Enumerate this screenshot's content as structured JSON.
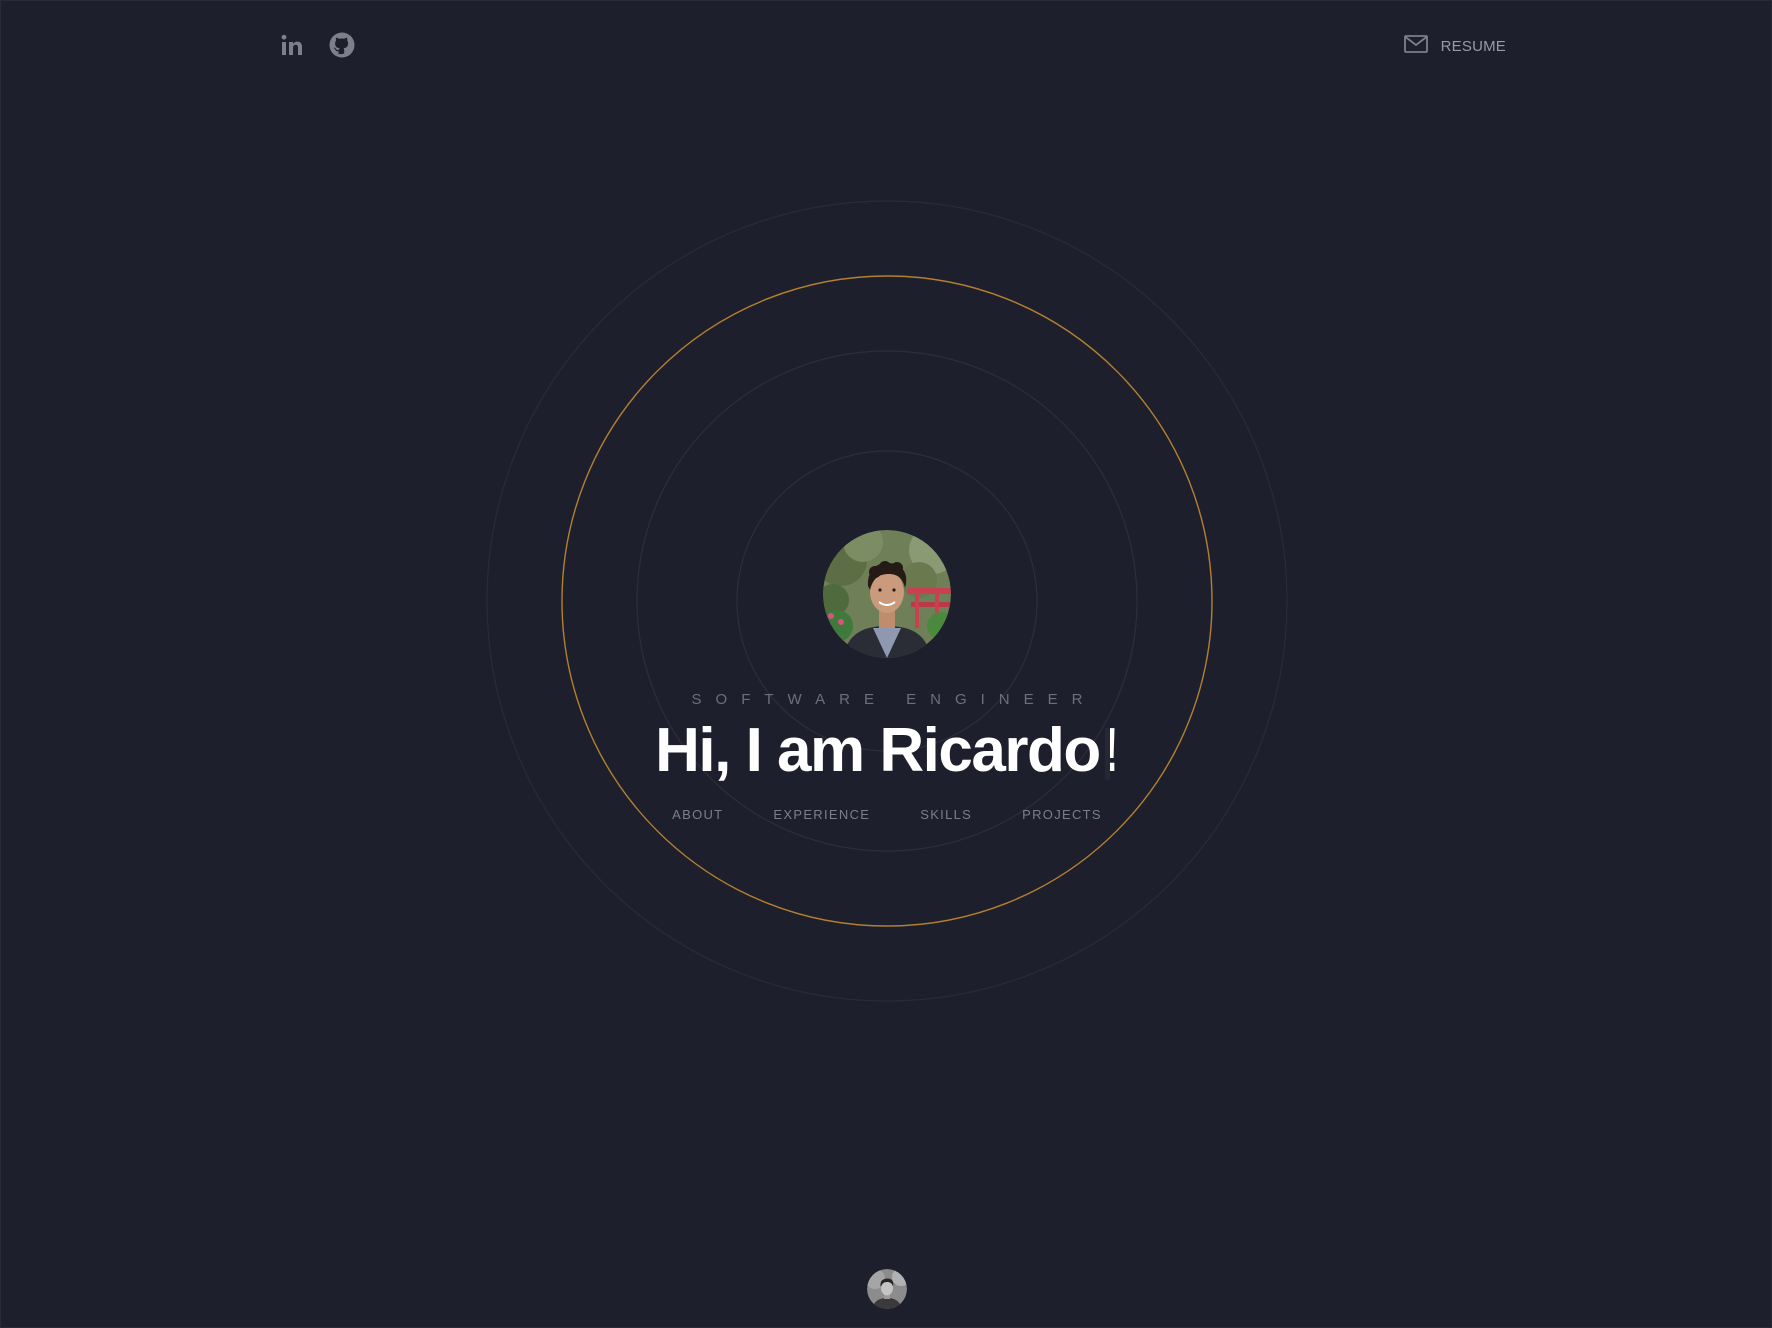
{
  "header": {
    "social": [
      {
        "name": "linkedin-icon",
        "label": "LinkedIn"
      },
      {
        "name": "github-icon",
        "label": "GitHub"
      }
    ],
    "resume_label": "RESUME",
    "resume_icon": "mail-icon"
  },
  "hero": {
    "role": "SOFTWARE ENGINEER",
    "headline": "Hi, I am Ricardo!"
  },
  "nav": {
    "items": [
      "ABOUT",
      "EXPERIENCE",
      "SKILLS",
      "PROJECTS"
    ]
  },
  "colors": {
    "background": "#1e1f2c",
    "accent_ring": "#b3802f",
    "muted_ring": "#2d2e3b",
    "headline": "#ffffff",
    "muted_text": "#7d7e8a"
  }
}
